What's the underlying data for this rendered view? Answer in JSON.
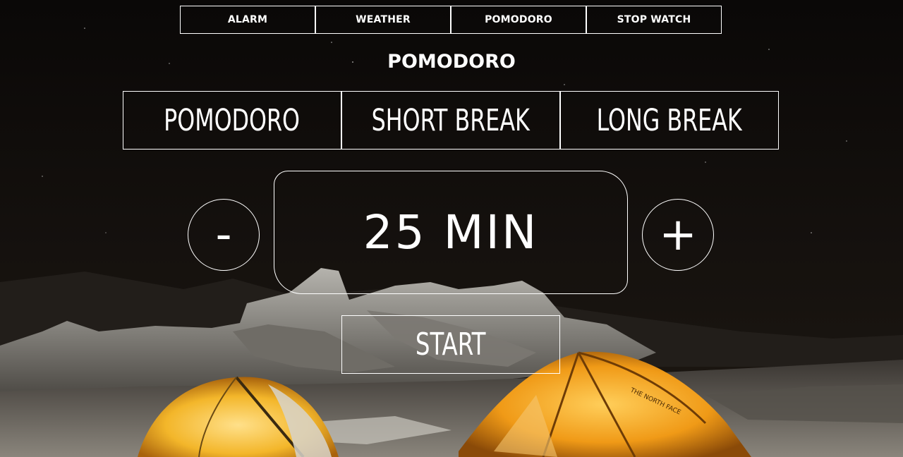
{
  "nav": {
    "items": [
      {
        "label": "ALARM"
      },
      {
        "label": "WEATHER"
      },
      {
        "label": "POMODORO"
      },
      {
        "label": "STOP WATCH"
      }
    ]
  },
  "page_title": "POMODORO",
  "modes": [
    {
      "label": "POMODORO"
    },
    {
      "label": "SHORT BREAK"
    },
    {
      "label": "LONG BREAK"
    }
  ],
  "timer": {
    "minus_label": "-",
    "plus_label": "+",
    "display": "25 MIN"
  },
  "start_label": "START",
  "colors": {
    "sky": "#0b0908",
    "tent": "#f4a51c",
    "rock": "#8d8c87",
    "border": "#ffffff"
  }
}
